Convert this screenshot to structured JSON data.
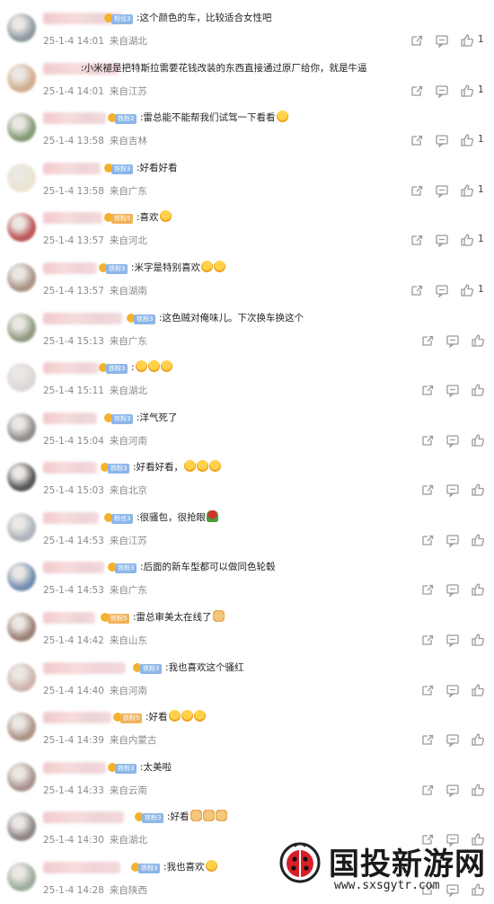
{
  "comments": [
    {
      "text": ":这个颜色的车，比较适合女性吧",
      "time": "25-1-4 14:01",
      "loc": "来自湖北",
      "likes": "1",
      "avatar": "#7a8a90",
      "badge": "blue",
      "badge_text": "粉丝3"
    },
    {
      "text": ":小米褪是把特斯拉需要花钱改装的东西直接通过原厂给你，就是牛逼",
      "time": "25-1-4 14:01",
      "loc": "来自江苏",
      "likes": "1",
      "avatar": "#c9a07a",
      "badge": "none",
      "badge_text": ""
    },
    {
      "text": ":雷总能不能帮我们试驾一下看看",
      "time": "25-1-4 13:58",
      "loc": "来自吉林",
      "likes": "1",
      "avatar": "#6f8a5c",
      "badge": "blue",
      "badge_text": "铁粉2",
      "emoji": "face"
    },
    {
      "text": ":好看好看",
      "time": "25-1-4 13:58",
      "loc": "来自广东",
      "likes": "1",
      "avatar": "#e8e0c8",
      "badge": "blue",
      "badge_text": "铁粉3"
    },
    {
      "text": ":喜欢",
      "time": "25-1-4 13:57",
      "loc": "来自河北",
      "likes": "1",
      "avatar": "#b03a3a",
      "badge": "orange",
      "badge_text": "铁粉5",
      "emoji": "face"
    },
    {
      "text": ":米字是特别喜欢",
      "time": "25-1-4 13:57",
      "loc": "来自湖南",
      "likes": "1",
      "avatar": "#9a8070",
      "badge": "blue",
      "badge_text": "铁粉3",
      "emoji": "face2"
    },
    {
      "text": ":这色贼对俺味儿。下次换车换这个",
      "time": "25-1-4 15:13",
      "loc": "来自广东",
      "likes": "",
      "avatar": "#7d8b6a",
      "badge": "blue",
      "badge_text": "铁粉3"
    },
    {
      "text": ":",
      "time": "25-1-4 15:11",
      "loc": "来自湖北",
      "likes": "",
      "avatar": "#d8d0d0",
      "badge": "blue",
      "badge_text": "铁粉3",
      "emoji": "face3"
    },
    {
      "text": ":洋气死了",
      "time": "25-1-4 15:04",
      "loc": "来自河南",
      "likes": "",
      "avatar": "#807a78",
      "badge": "blue",
      "badge_text": "铁粉3"
    },
    {
      "text": ":好看好看，",
      "time": "25-1-4 15:03",
      "loc": "来自北京",
      "likes": "",
      "avatar": "#3a3a3a",
      "badge": "blue",
      "badge_text": "铁粉3",
      "emoji": "face3"
    },
    {
      "text": ":很骚包，很抢眼",
      "time": "25-1-4 14:53",
      "loc": "来自江苏",
      "likes": "",
      "avatar": "#a0a8b0",
      "badge": "blue",
      "badge_text": "粉丝3",
      "emoji": "rose"
    },
    {
      "text": ":后面的新车型都可以做同色轮毂",
      "time": "25-1-4 14:53",
      "loc": "来自广东",
      "likes": "",
      "avatar": "#5a7aa0",
      "badge": "blue",
      "badge_text": "铁粉3"
    },
    {
      "text": ":雷总审美太在线了",
      "time": "25-1-4 14:42",
      "loc": "来自山东",
      "likes": "",
      "avatar": "#8a6a5a",
      "badge": "orange",
      "badge_text": "铁粉5",
      "emoji": "thumb"
    },
    {
      "text": ":我也喜欢这个骚红",
      "time": "25-1-4 14:40",
      "loc": "来自河南",
      "likes": "",
      "avatar": "#c8a8a0",
      "badge": "blue",
      "badge_text": "铁粉3"
    },
    {
      "text": ":好看",
      "time": "25-1-4 14:39",
      "loc": "来自内蒙古",
      "likes": "",
      "avatar": "#a08070",
      "badge": "orange",
      "badge_text": "铁粉5",
      "emoji": "face3"
    },
    {
      "text": ":太美啦",
      "time": "25-1-4 14:33",
      "loc": "来自云南",
      "likes": "",
      "avatar": "#9a8078",
      "badge": "blue",
      "badge_text": "铁粉3"
    },
    {
      "text": ":好看",
      "time": "25-1-4 14:30",
      "loc": "来自湖北",
      "likes": "",
      "avatar": "#7a7070",
      "badge": "blue",
      "badge_text": "铁粉3",
      "emoji": "thumb3"
    },
    {
      "text": ":我也喜欢",
      "time": "25-1-4 14:28",
      "loc": "来自陕西",
      "likes": "",
      "avatar": "#8aa08a",
      "badge": "blue",
      "badge_text": "铁粉3",
      "emoji": "face"
    }
  ],
  "watermark": {
    "title": "国投新游网",
    "url": "www.sxsgytr.com"
  },
  "icons": {
    "share": "share-icon",
    "comment": "comment-icon",
    "like": "thumb-up-icon"
  },
  "colors": {
    "meta": "#8a8a8a",
    "icon": "#9a9a9a",
    "badge_blue": "#8cb6e8",
    "badge_orange": "#f0b35a"
  }
}
